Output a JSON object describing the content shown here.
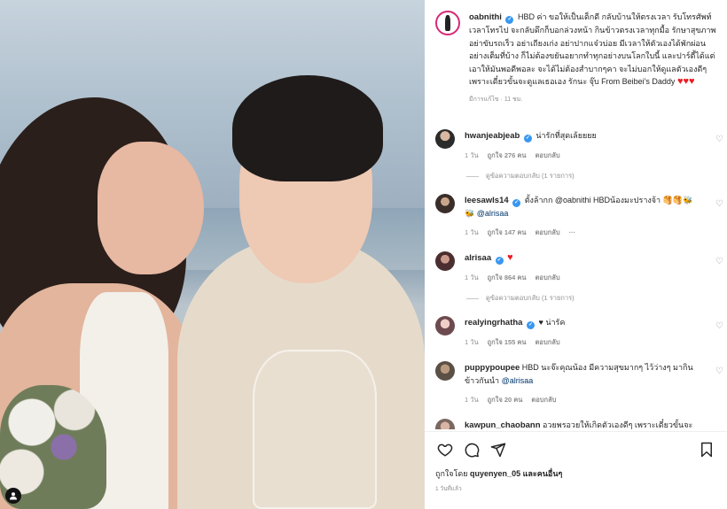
{
  "post": {
    "username": "oabnithi",
    "caption_text": "HBD ค่า ขอให้เป็นเด็กดี กลับบ้านให้ตรงเวลา รับโทรศัพท์เวลาโทรไป จะกลับดึกก็บอกล่วงหน้า กินข้าวตรงเวลาทุกมื้อ รักษาสุขภาพ อย่าขับรถเร็ว อย่าเถียงเก่ง อย่าปากแจ๋วบ่อย มีเวลาให้ตัวเองได้พักผ่อนอย่างเต็มที่บ้าง ก็ไม่ต้องขยันอยากทำทุกอย่างบนโลกใบนี้ และปาร์ตี้ได้แต่เอาให้มันพอดีพอละ จะได้ไม่ต้องสำบากๆคา จะไม่บอกให้ดูแลตัวเองดีๆ เพราะเดี๋ยวขั้นจะดูแลเธอเอง รักนะ จุ๊บ From Beibei's Daddy",
    "caption_hearts": "♥♥♥",
    "meta": "มีการแก้ไข · 11 ชม."
  },
  "comments": [
    {
      "username": "hwanjeabjeab",
      "verified": true,
      "text": "น่ารักที่สุดเล้ยยยย",
      "mention": "",
      "time": "1 วัน",
      "likes": "ถูกใจ 276 คน",
      "reply": "ตอบกลับ",
      "more": "",
      "replies": "ดูข้อความตอบกลับ (1 รายการ)"
    },
    {
      "username": "leesawls14",
      "verified": true,
      "text": "ตั้งล้ากก @oabnithi HBDน้องมะปรางจ้า 🥞🥞🐝",
      "mention": "🐝 @alrisaa",
      "time": "1 วัน",
      "likes": "ถูกใจ 147 คน",
      "reply": "ตอบกลับ",
      "more": "···",
      "replies": ""
    },
    {
      "username": "alrisaa",
      "verified": true,
      "text": "♥",
      "mention": "",
      "time": "1 วัน",
      "likes": "ถูกใจ 864 คน",
      "reply": "ตอบกลับ",
      "more": "",
      "replies": "ดูข้อความตอบกลับ (1 รายการ)"
    },
    {
      "username": "realyingrhatha",
      "verified": true,
      "text": "♥ น่ารัค",
      "mention": "",
      "time": "1 วัน",
      "likes": "ถูกใจ 155 คน",
      "reply": "ตอบกลับ",
      "more": "",
      "replies": ""
    },
    {
      "username": "puppypoupee",
      "verified": false,
      "text": "HBD นะจ๊ะคุณน้อง มีความสุขมากๆ ไว้ว่างๆ มากินข้าวกันนำ",
      "mention": "@alrisaa",
      "time": "1 วัน",
      "likes": "ถูกใจ 20 คน",
      "reply": "ตอบกลับ",
      "more": "",
      "replies": ""
    },
    {
      "username": "kawpun_chaobann",
      "verified": false,
      "text": "อวยพรอวยให้เกิดตัวเองดีๆ เพราะเดี๋ยวขั้นจะ",
      "mention": "",
      "time": "",
      "likes": "",
      "reply": "",
      "more": "",
      "replies": ""
    }
  ],
  "footer": {
    "liked_by_prefix": "ถูกใจโดย",
    "liked_by_user": "quyenyen_05",
    "liked_by_suffix": "และคนอื่นๆ",
    "time": "1 วันที่แล้ว"
  },
  "icons": {
    "verified": "verified-badge-icon",
    "like": "heart-outline-icon",
    "comment": "speech-bubble-icon",
    "share": "paper-plane-icon",
    "save": "bookmark-icon",
    "user_tag": "person-icon"
  },
  "colors": {
    "accent_blue": "#3897f0",
    "heart_red": "#ed1c24",
    "muted_text": "#8e8e8e"
  }
}
